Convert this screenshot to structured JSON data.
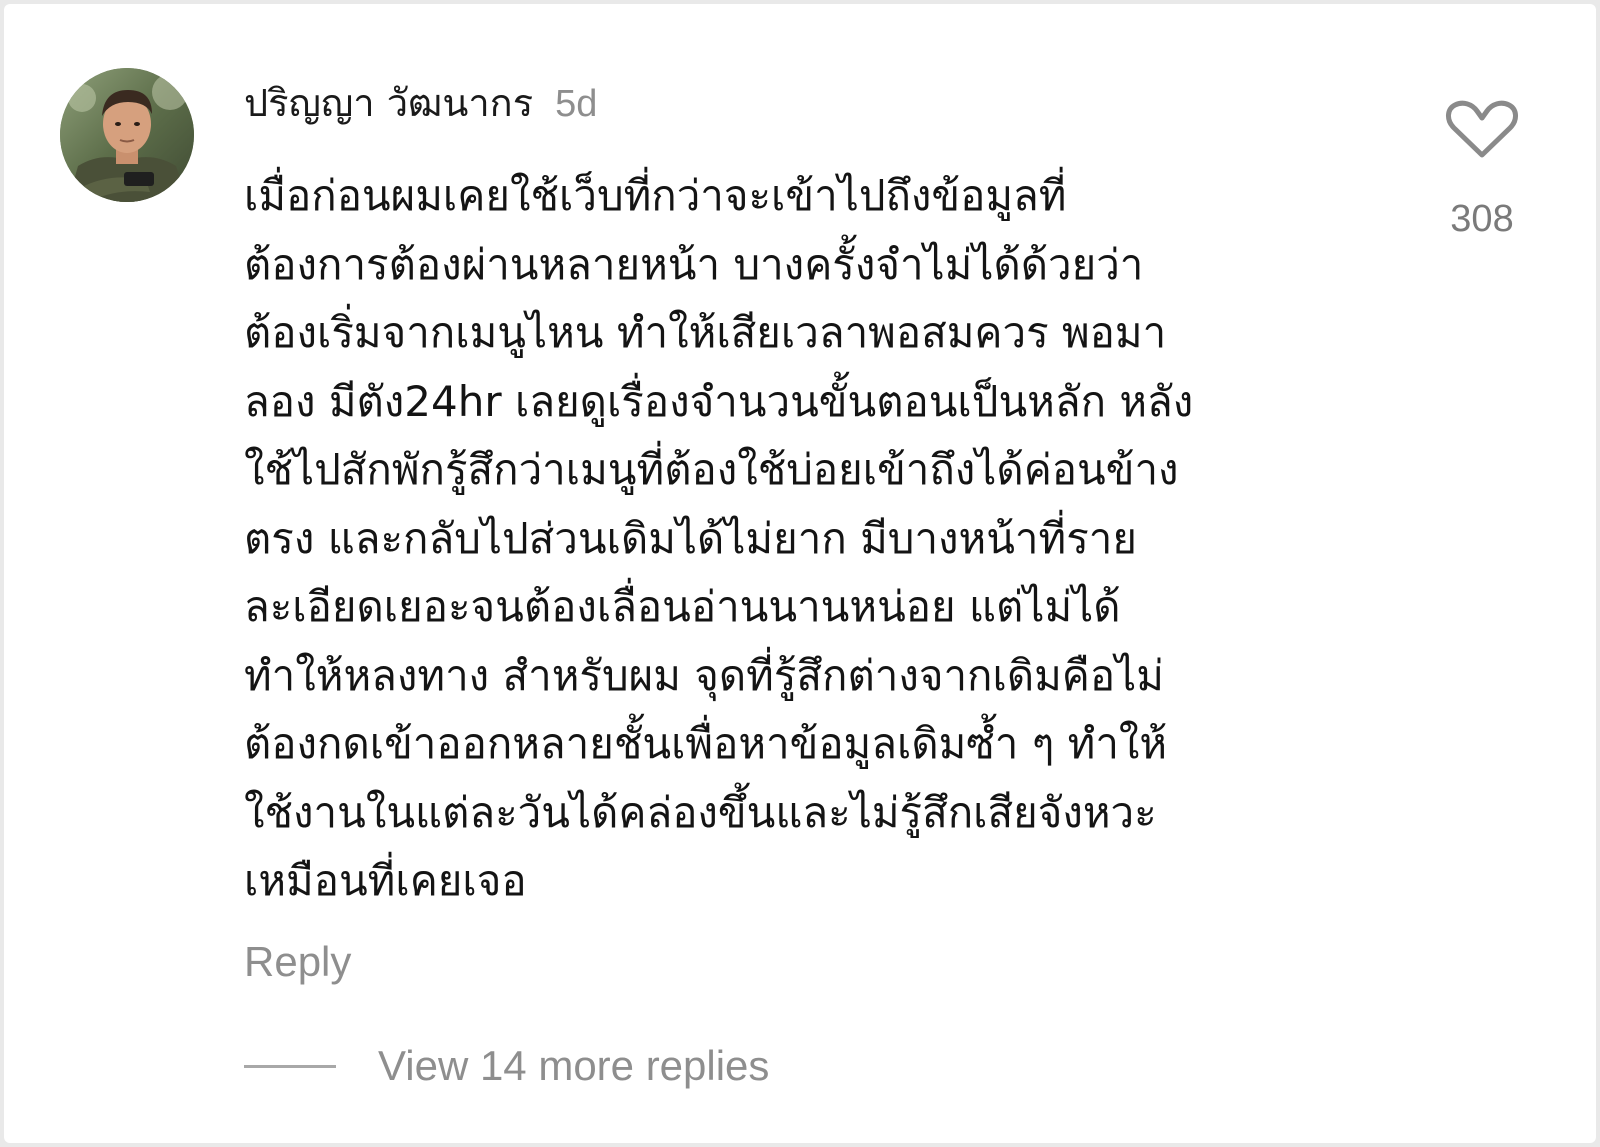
{
  "comment": {
    "avatar": "avatar-photo",
    "username": "ปริญญา วัฒนากร",
    "timestamp": "5d",
    "body_lines": [
      "เมื่อก่อนผมเคยใช้เว็บที่กว่าจะเข้าไปถึงข้อมูลที่",
      "ต้องการต้องผ่านหลายหน้า บางครั้งจำไม่ได้ด้วยว่า",
      "ต้องเริ่มจากเมนูไหน ทำให้เสียเวลาพอสมควร พอมา",
      "ลอง มีตัง24hr เลยดูเรื่องจำนวนขั้นตอนเป็นหลัก หลัง",
      "ใช้ไปสักพักรู้สึกว่าเมนูที่ต้องใช้บ่อยเข้าถึงได้ค่อนข้าง",
      "ตรง และกลับไปส่วนเดิมได้ไม่ยาก มีบางหน้าที่ราย",
      "ละเอียดเยอะจนต้องเลื่อนอ่านนานหน่อย แต่ไม่ได้",
      "ทำให้หลงทาง สำหรับผม จุดที่รู้สึกต่างจากเดิมคือไม่",
      "ต้องกดเข้าออกหลายชั้นเพื่อหาข้อมูลเดิมซ้ำ ๆ ทำให้",
      "ใช้งานในแต่ละวันได้คล่องขึ้นและไม่รู้สึกเสียจังหวะ",
      "เหมือนที่เคยเจอ"
    ],
    "like_icon": "heart-outline-icon",
    "like_count": "308",
    "reply_label": "Reply",
    "view_replies_label": "View 14 more replies"
  },
  "colors": {
    "background": "#ffffff",
    "primary_text": "#141414",
    "secondary_text": "#8e8e8e"
  }
}
